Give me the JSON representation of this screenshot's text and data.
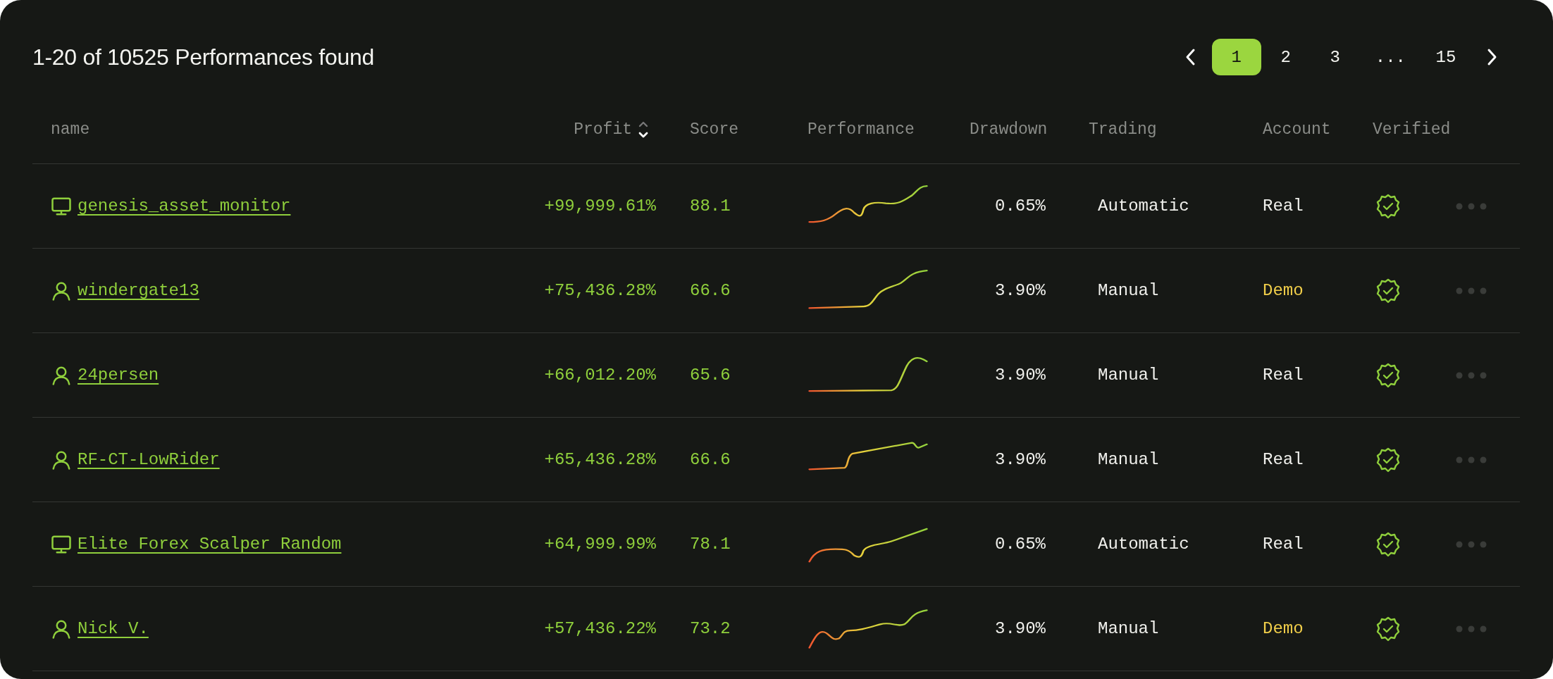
{
  "title": "1-20 of 10525 Performances found",
  "pagination": {
    "pages": [
      {
        "label": "1",
        "selected": true
      },
      {
        "label": "2",
        "selected": false
      },
      {
        "label": "3",
        "selected": false
      },
      {
        "label": "...",
        "kind": "gap"
      },
      {
        "label": "15",
        "selected": false
      }
    ]
  },
  "table": {
    "columns": [
      {
        "label": "name"
      },
      {
        "label": "Profit",
        "sort_descending": true
      },
      {
        "label": "Score"
      },
      {
        "label": "Performance"
      },
      {
        "label": "Drawdown"
      },
      {
        "label": "Trading"
      },
      {
        "label": "Account"
      },
      {
        "label": "Verified"
      }
    ],
    "rows": [
      {
        "kind": "bot",
        "name": "genesis_asset_monitor",
        "profit": "+99,999.61%",
        "score": "88.1",
        "drawdown": "0.65%",
        "trading": "Automatic",
        "account": {
          "label": "Real",
          "color": "#f0f0ec"
        },
        "verified": true
      },
      {
        "kind": "user",
        "name": "windergate13",
        "profit": "+75,436.28%",
        "score": "66.6",
        "drawdown": "3.90%",
        "trading": "Manual",
        "account": {
          "label": "Demo",
          "color": "#f2cf4a"
        },
        "verified": true
      },
      {
        "kind": "user",
        "name": "24persen",
        "profit": "+66,012.20%",
        "score": "65.6",
        "drawdown": "3.90%",
        "trading": "Manual",
        "account": {
          "label": "Real",
          "color": "#f0f0ec"
        },
        "verified": true
      },
      {
        "kind": "user",
        "name": "RF-CT-LowRider",
        "profit": "+65,436.28%",
        "score": "66.6",
        "drawdown": "3.90%",
        "trading": "Manual",
        "account": {
          "label": "Real",
          "color": "#f0f0ec"
        },
        "verified": true
      },
      {
        "kind": "bot",
        "name": "Elite Forex Scalper Random",
        "profit": "+64,999.99%",
        "score": "78.1",
        "drawdown": "0.65%",
        "trading": "Automatic",
        "account": {
          "label": "Real",
          "color": "#f0f0ec"
        },
        "verified": true
      },
      {
        "kind": "user",
        "name": "Nick V.",
        "profit": "+57,436.22%",
        "score": "73.2",
        "drawdown": "3.90%",
        "trading": "Manual",
        "account": {
          "label": "Demo",
          "color": "#f2cf4a"
        },
        "verified": true
      }
    ]
  }
}
